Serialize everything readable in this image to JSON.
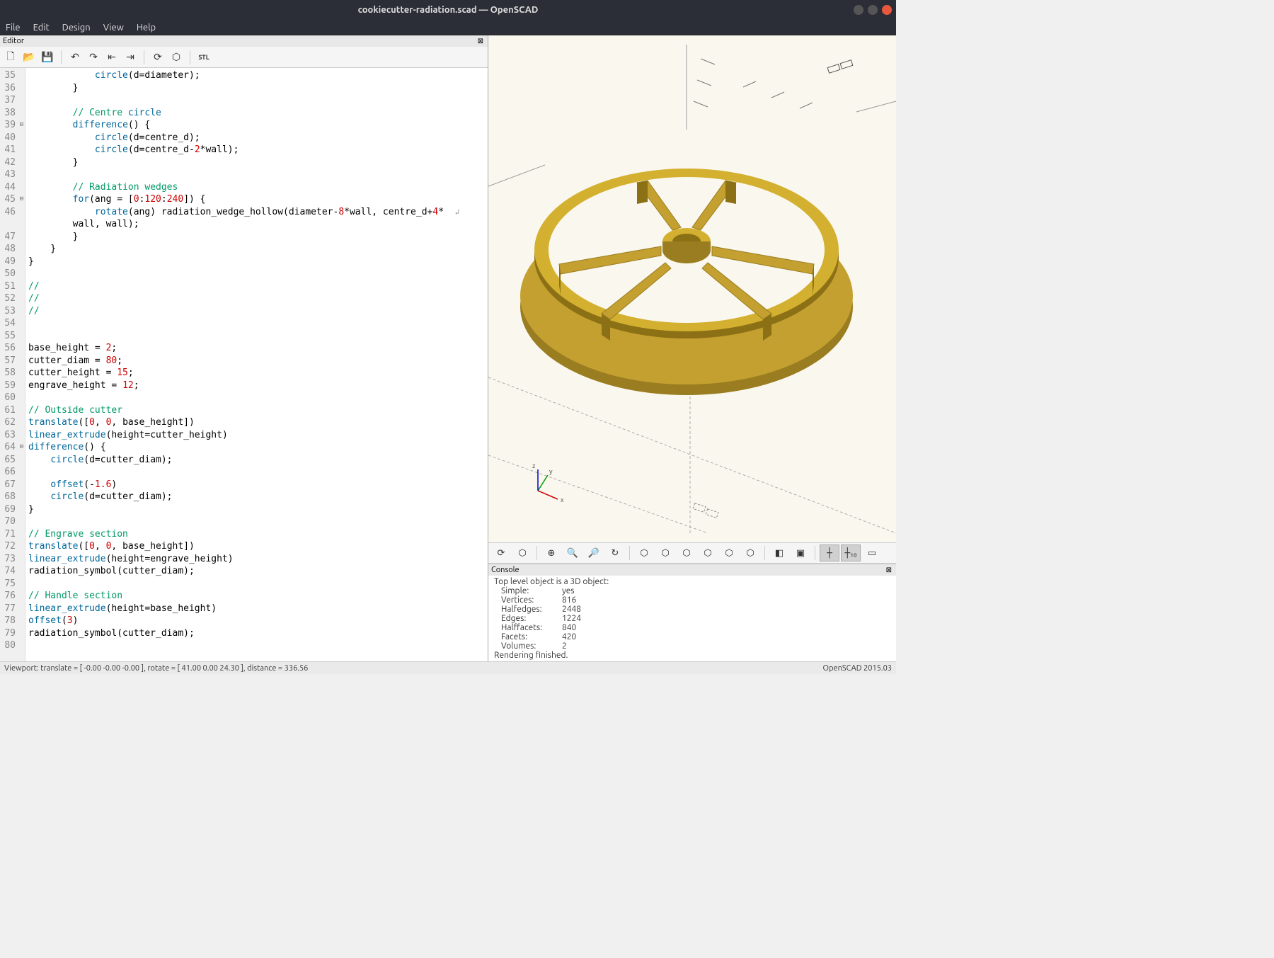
{
  "window": {
    "title": "cookiecutter-radiation.scad — OpenSCAD"
  },
  "menubar": [
    "File",
    "Edit",
    "Design",
    "View",
    "Help"
  ],
  "editor": {
    "title": "Editor",
    "first_line": 35,
    "lines": [
      "            circle(d=diameter);",
      "        }",
      "",
      "        // Centre circle",
      "        difference() {",
      "            circle(d=centre_d);",
      "            circle(d=centre_d-2*wall);",
      "        }",
      "",
      "        // Radiation wedges",
      "        for(ang = [0:120:240]) {",
      "            rotate(ang) radiation_wedge_hollow(diameter-8*wall, centre_d+4*",
      "        wall, wall);",
      "        }",
      "    }",
      "}",
      "",
      "//",
      "//",
      "//",
      "",
      "",
      "base_height = 2;",
      "cutter_diam = 80;",
      "cutter_height = 15;",
      "engrave_height = 12;",
      "",
      "// Outside cutter",
      "translate([0, 0, base_height])",
      "linear_extrude(height=cutter_height)",
      "difference() {",
      "    circle(d=cutter_diam);",
      "",
      "    offset(-1.6)",
      "    circle(d=cutter_diam);",
      "}",
      "",
      "// Engrave section",
      "translate([0, 0, base_height])",
      "linear_extrude(height=engrave_height)",
      "radiation_symbol(cutter_diam);",
      "",
      "// Handle section",
      "linear_extrude(height=base_height)",
      "offset(3)",
      "radiation_symbol(cutter_diam);",
      ""
    ],
    "fold_markers": {
      "39": "⊟",
      "45": "⊟",
      "64": "⊟"
    }
  },
  "console": {
    "title": "Console",
    "lines": [
      [
        "",
        "",
        "Top level object is a 3D object:"
      ],
      [
        "",
        "Simple:",
        "yes"
      ],
      [
        "",
        "Vertices:",
        "816"
      ],
      [
        "",
        "Halfedges:",
        "2448"
      ],
      [
        "",
        "Edges:",
        "1224"
      ],
      [
        "",
        "Halffacets:",
        "840"
      ],
      [
        "",
        "Facets:",
        "420"
      ],
      [
        "",
        "Volumes:",
        "2"
      ],
      [
        "",
        "",
        "Rendering finished."
      ]
    ]
  },
  "statusbar": {
    "left": "Viewport: translate = [ -0.00 -0.00 -0.00 ], rotate = [ 41.00 0.00 24.30 ], distance = 336.56",
    "right": "OpenSCAD 2015.03"
  },
  "axis_labels": {
    "x": "x",
    "y": "y",
    "z": "z"
  }
}
